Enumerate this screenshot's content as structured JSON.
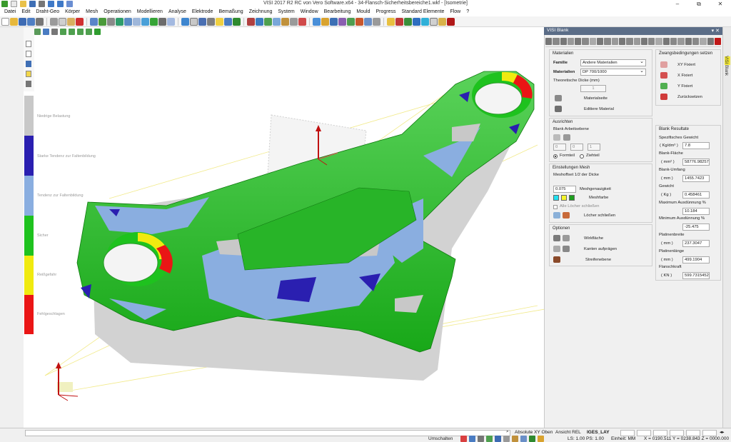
{
  "window": {
    "title": "VISI 2017 R2 RC von Vero Software.x64 - 34-Flansch-Sicherheitsbereiche1.wkf - [Isometrie]",
    "minimize": "–",
    "restore": "⧉",
    "close": "✕"
  },
  "menu": [
    "Datei",
    "Edit",
    "Draht-Geo",
    "Körper",
    "Mesh",
    "Operationen",
    "Modellieren",
    "Analyse",
    "Elektrode",
    "Bemaßung",
    "Zeichnung",
    "System",
    "Window",
    "Bearbeitung",
    "Mould",
    "Progress",
    "Standard Elemente",
    "Flow",
    "?"
  ],
  "legend": {
    "colors": [
      "#c8c8c8",
      "#2a1fb0",
      "#8aaee0",
      "#1ec21e",
      "#f0ea10",
      "#ea1515"
    ],
    "labels": [
      "Niedrige Belastung",
      "Starke Tendenz zur Faltenbildung",
      "Tendenz zur Faltenbildung",
      "Sicher",
      "Reißgefahr",
      "Fehlgeschlagen"
    ]
  },
  "panel": {
    "title": "VISI Blank",
    "pin": "▾ ✕",
    "sidetab": "VISI Blank",
    "materialien": {
      "title": "Materialien",
      "familie_label": "Familie",
      "familie_value": "Andere Materialien",
      "materialien_label": "Materialien",
      "materialien_value": "DP 700/1000",
      "dicke_label": "Theoretische Dicke (mm)",
      "dicke_value": "1",
      "materialseite": "Materialseite",
      "edit_material": "Editiere Material"
    },
    "zwang": {
      "title": "Zwangsbedingungen setzen",
      "xy": "XY Fixiert",
      "x": "X Fixiert",
      "y": "Y Fixiert",
      "reset": "Zurücksetzen"
    },
    "ausrichten": {
      "title": "Ausrichten",
      "ebene": "Blank Arbeitsebene",
      "v1": "0",
      "v2": "0",
      "v3": "1",
      "formteil": "Formteil",
      "ziehteil": "Ziehteil"
    },
    "mesh": {
      "title": "Einstellungen Mesh",
      "offset": "Meshoffset 1/2 der Dicke",
      "genauigkeit_value": "0.075",
      "genauigkeit_label": "Meshgenauigkeit",
      "farbe": "Meshfarbe",
      "swatches": [
        "#22e0f0",
        "#f5f52a",
        "#1e9e1e"
      ],
      "alle_loecher": "Alle Löcher schließen",
      "loecher": "Löcher schließen"
    },
    "optionen": {
      "title": "Optionen",
      "wirkflaeche": "Wirkfläche",
      "kanten": "Kanten aufprägen",
      "streifen": "Streifenebene"
    },
    "results": {
      "title": "Blank Resultate",
      "gewicht_spez_label": "Spezifisches Gewicht",
      "gewicht_spez_unit": "( Kg/dm³ )",
      "gewicht_spez_value": "7.8",
      "flaeche_label": "Blank-Fläche",
      "flaeche_unit": "( mm² )",
      "flaeche_value": "58776.982571",
      "umfang_label": "Blank-Umfang",
      "umfang_unit": "( mm )",
      "umfang_value": "1455.7423",
      "gewicht_label": "Gewicht",
      "gewicht_unit": "( Kg )",
      "gewicht_value": "0.458461",
      "max_label": "Maximum Ausdünnung %",
      "max_value": "10.184",
      "min_label": "Minimum Ausdünnung %",
      "min_value": "-25.475",
      "breite_label": "Platinenbreite",
      "breite_unit": "( mm )",
      "breite_value": "237.3047",
      "laenge_label": "Platinenlänge",
      "laenge_unit": "( mm )",
      "laenge_value": "499.1904",
      "kraft_label": "Flanschkraft",
      "kraft_unit": "( KN )",
      "kraft_value": "599.7315452"
    }
  },
  "status": {
    "umschalten": "Umschalten",
    "absolute": "Absolute XY Oben",
    "ansicht": "Ansicht REL",
    "layer": "IGES_LAY",
    "ls": "LS: 1.00 PS: 1.00",
    "einheit": "Einheit: MM",
    "coords": "X = 0190.511 Y = 0238.843 Z = 0000.000"
  }
}
